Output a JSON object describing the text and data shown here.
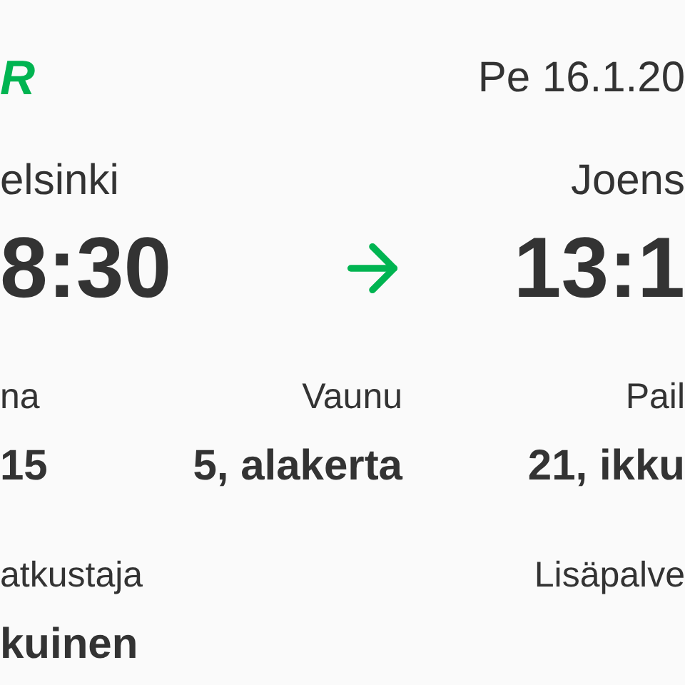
{
  "logo": {
    "text": "R"
  },
  "date": "Pe 16.1.20",
  "departure": {
    "station": "elsinki",
    "time": "8:30"
  },
  "arrival": {
    "station": "Joens",
    "time": "13:1"
  },
  "details": [
    {
      "label": "na",
      "value": "15"
    },
    {
      "label": "Vaunu",
      "value": "5, alakerta"
    },
    {
      "label": "Pail",
      "value": "21, ikku"
    }
  ],
  "extra": [
    {
      "label": "atkustaja",
      "value": "kuinen"
    },
    {
      "label": "Lisäpalve"
    }
  ]
}
